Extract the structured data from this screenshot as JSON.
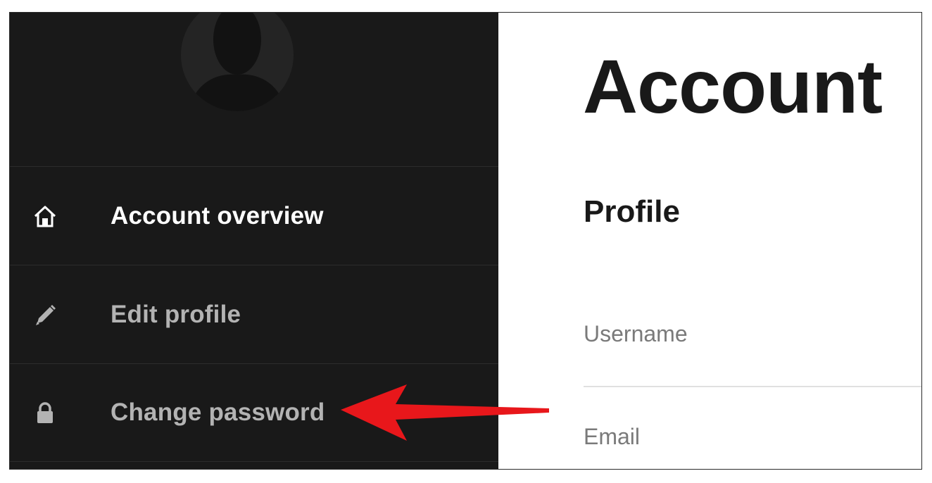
{
  "sidebar": {
    "items": [
      {
        "label": "Account overview",
        "icon": "home-icon",
        "active": true
      },
      {
        "label": "Edit profile",
        "icon": "pencil-icon",
        "active": false
      },
      {
        "label": "Change password",
        "icon": "lock-icon",
        "active": false
      }
    ]
  },
  "main": {
    "title": "Account",
    "section_title": "Profile",
    "fields": [
      {
        "label": "Username"
      },
      {
        "label": "Email"
      }
    ]
  },
  "annotation": {
    "type": "red-arrow",
    "points_to": "Change password",
    "color": "#e8171b"
  },
  "colors": {
    "sidebar_bg": "#191919",
    "active_text": "#ffffff",
    "inactive_text": "#b3b3b3",
    "title_text": "#191919",
    "field_label": "#7a7a7a"
  }
}
